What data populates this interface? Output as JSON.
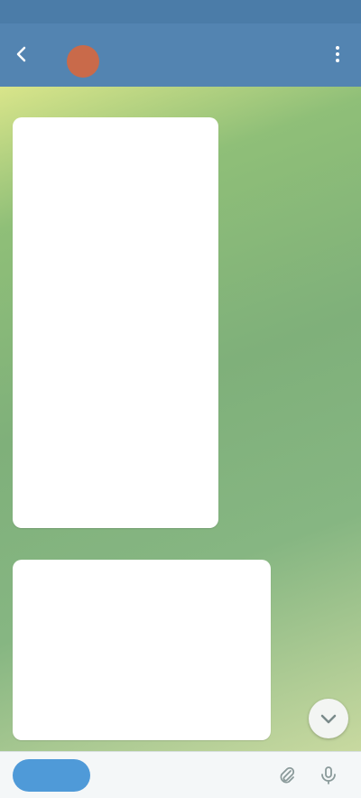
{
  "status_bar": {
    "time": "",
    "icons": ""
  },
  "header": {
    "title": "",
    "subtitle": ""
  },
  "messages": [
    {
      "lines": [
        "",
        "",
        "",
        "",
        "",
        "",
        ""
      ],
      "meta": ""
    },
    {
      "lines": [
        "",
        "",
        "",
        ""
      ],
      "meta": ""
    }
  ],
  "input": {
    "button_label": "",
    "placeholder": ""
  },
  "colors": {
    "header": "#5384b1",
    "status_bar": "#4b7ca8",
    "accent": "#4f9ad8",
    "bubble": "#ffffff",
    "chat_background": "#7fb07a"
  },
  "icons": {
    "back": "back-arrow-icon",
    "menu": "more-vertical-icon",
    "scroll": "chevron-down-icon",
    "attach": "paperclip-icon",
    "voice": "microphone-icon"
  }
}
